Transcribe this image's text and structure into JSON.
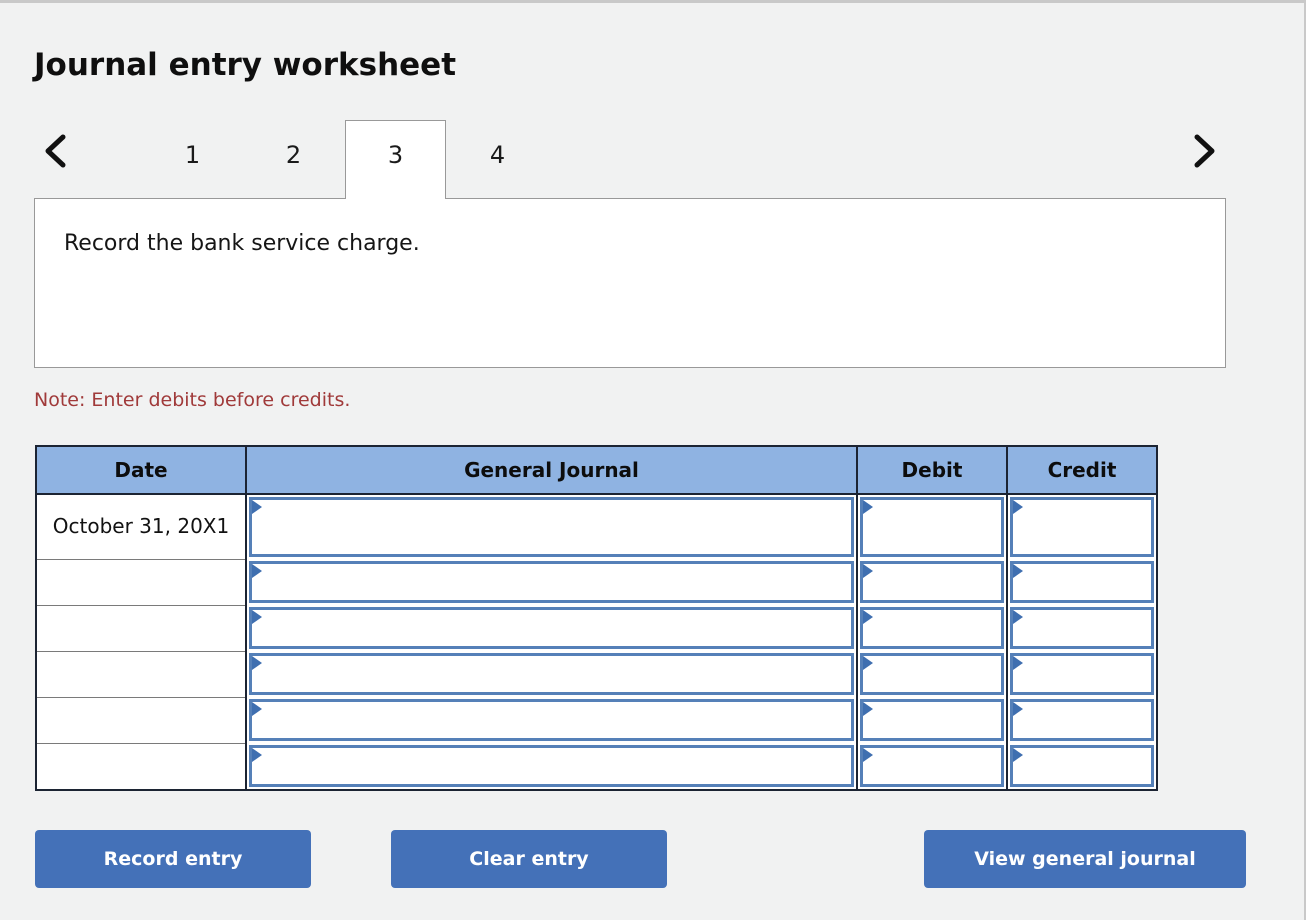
{
  "page": {
    "title": "Journal entry worksheet",
    "background_color": "#f1f2f2"
  },
  "tabs": {
    "prev_icon": "chevron-left-icon",
    "next_icon": "chevron-right-icon",
    "items": [
      {
        "label": "1",
        "active": false
      },
      {
        "label": "2",
        "active": false
      },
      {
        "label": "3",
        "active": true
      },
      {
        "label": "4",
        "active": false
      }
    ],
    "active_index": 2
  },
  "instruction": {
    "text": "Record the bank service charge."
  },
  "note": {
    "text": "Note: Enter debits before credits.",
    "color": "#a03a3a"
  },
  "table": {
    "header_color": "#8fb3e2",
    "input_border_color": "#5580b8",
    "columns": [
      {
        "key": "date",
        "label": "Date"
      },
      {
        "key": "gj",
        "label": "General Journal"
      },
      {
        "key": "debit",
        "label": "Debit"
      },
      {
        "key": "credit",
        "label": "Credit"
      }
    ],
    "rows": [
      {
        "date": "October 31, 20X1",
        "gj": "",
        "debit": "",
        "credit": ""
      },
      {
        "date": "",
        "gj": "",
        "debit": "",
        "credit": ""
      },
      {
        "date": "",
        "gj": "",
        "debit": "",
        "credit": ""
      },
      {
        "date": "",
        "gj": "",
        "debit": "",
        "credit": ""
      },
      {
        "date": "",
        "gj": "",
        "debit": "",
        "credit": ""
      },
      {
        "date": "",
        "gj": "",
        "debit": "",
        "credit": ""
      }
    ]
  },
  "buttons": {
    "record": "Record entry",
    "clear": "Clear entry",
    "view": "View general journal",
    "color": "#4471b8"
  }
}
